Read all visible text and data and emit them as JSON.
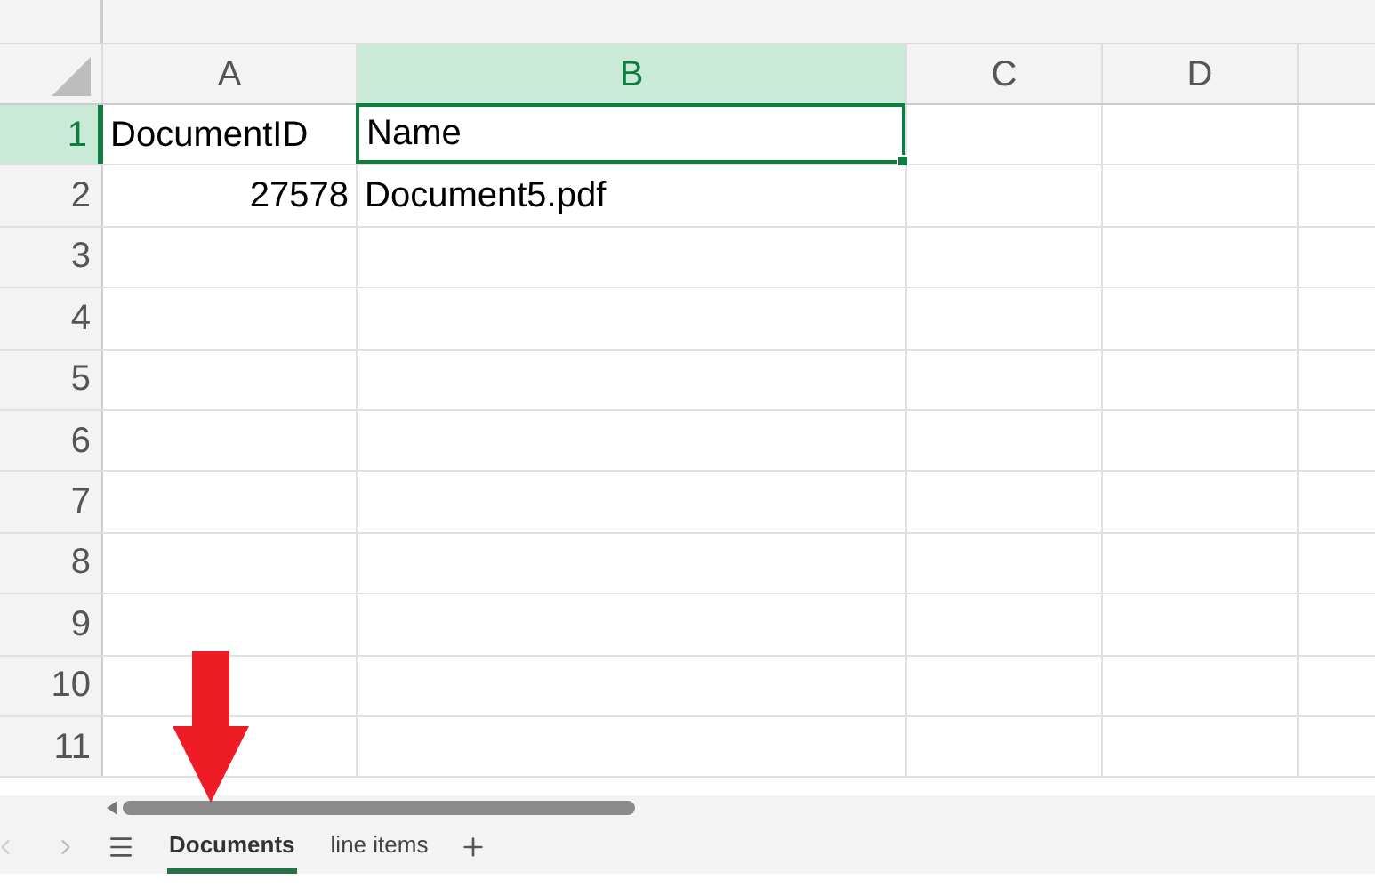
{
  "columns": [
    {
      "label": "A",
      "selected": false
    },
    {
      "label": "B",
      "selected": true
    },
    {
      "label": "C",
      "selected": false
    },
    {
      "label": "D",
      "selected": false
    }
  ],
  "rows": [
    {
      "label": "1",
      "selected": true,
      "cells": [
        {
          "text": "DocumentID",
          "kind": "text",
          "active": false
        },
        {
          "text": "Name",
          "kind": "text",
          "active": true
        }
      ]
    },
    {
      "label": "2",
      "selected": false,
      "cells": [
        {
          "text": "27578",
          "kind": "number",
          "active": false
        },
        {
          "text": "Document5.pdf",
          "kind": "text",
          "active": false
        }
      ]
    },
    {
      "label": "3",
      "selected": false
    },
    {
      "label": "4",
      "selected": false
    },
    {
      "label": "5",
      "selected": false
    },
    {
      "label": "6",
      "selected": false
    },
    {
      "label": "7",
      "selected": false
    },
    {
      "label": "8",
      "selected": false
    },
    {
      "label": "9",
      "selected": false
    },
    {
      "label": "10",
      "selected": false
    },
    {
      "label": "11",
      "selected": false
    }
  ],
  "sheet_tabs": [
    {
      "label": "Documents",
      "selected": true
    },
    {
      "label": "line items",
      "selected": false
    }
  ]
}
